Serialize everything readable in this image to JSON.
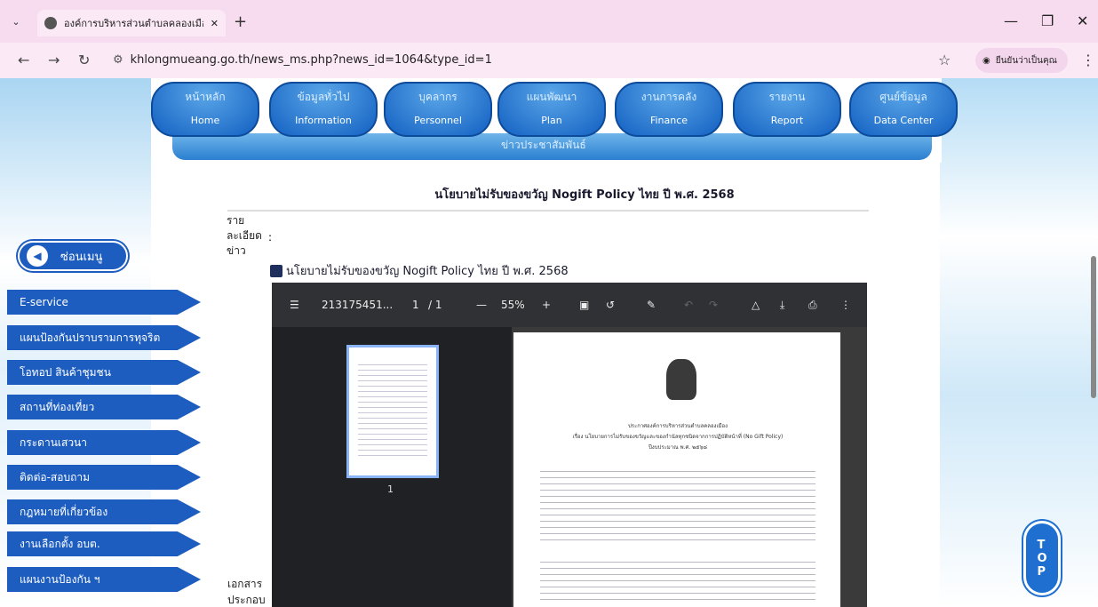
{
  "browser": {
    "tab_title": "องค์การบริหารส่วนตำบลคลองเมือง :",
    "url": "khlongmueang.go.th/news_ms.php?news_id=1064&type_id=1",
    "profile_label": "ยืนยันว่าเป็นคุณ"
  },
  "menu": [
    {
      "th": "หน้าหลัก",
      "en": "Home"
    },
    {
      "th": "ข้อมูลทั่วไป",
      "en": "Information"
    },
    {
      "th": "บุคลากร",
      "en": "Personnel"
    },
    {
      "th": "แผนพัฒนา",
      "en": "Plan"
    },
    {
      "th": "งานการคลัง",
      "en": "Finance"
    },
    {
      "th": "รายงาน",
      "en": "Report"
    },
    {
      "th": "ศูนย์ข้อมูล",
      "en": "Data Center"
    }
  ],
  "submenu": "ข่าวประชาสัมพันธ์",
  "article": {
    "title": "นโยบายไม่รับของขวัญ Nogift Policy ไทย ปี พ.ศ. 2568",
    "detail_label": "รายละเอียดข่าว",
    "colon": ":",
    "file_name": "นโยบายไม่รับของขวัญ Nogift Policy ไทย ปี พ.ศ. 2568",
    "attach_label_1": "เอกสาร",
    "attach_label_2": "ประกอบ"
  },
  "sidebar": {
    "hide_label": "ซ่อนเมนู",
    "items": [
      "E-service",
      "แผนป้องกันปราบรามการทุจริต",
      "โอทอป สินค้าชุมชน",
      "สถานที่ท่องเที่ยว",
      "กระดานเสวนา",
      "ติดต่อ-สอบถาม",
      "กฎหมายที่เกี่ยวข้อง",
      "งานเลือกตั้ง อบต.",
      "แผนงานป้องกัน ฯ"
    ]
  },
  "pdf": {
    "file": "213175451...",
    "page": "1",
    "total": "/ 1",
    "zoom": "55%",
    "thumb_page": "1"
  },
  "doc": {
    "h1": "ประกาศองค์การบริหารส่วนตำบลคลองเมือง",
    "h2": "เรื่อง นโยบายการไม่รับของขวัญและของกำนัลทุกชนิดจากการปฏิบัติหน้าที่ (No Gift Policy)",
    "h3": "ปีงบประมาณ พ.ศ. ๒๕๖๘"
  },
  "top_label": "TOP"
}
